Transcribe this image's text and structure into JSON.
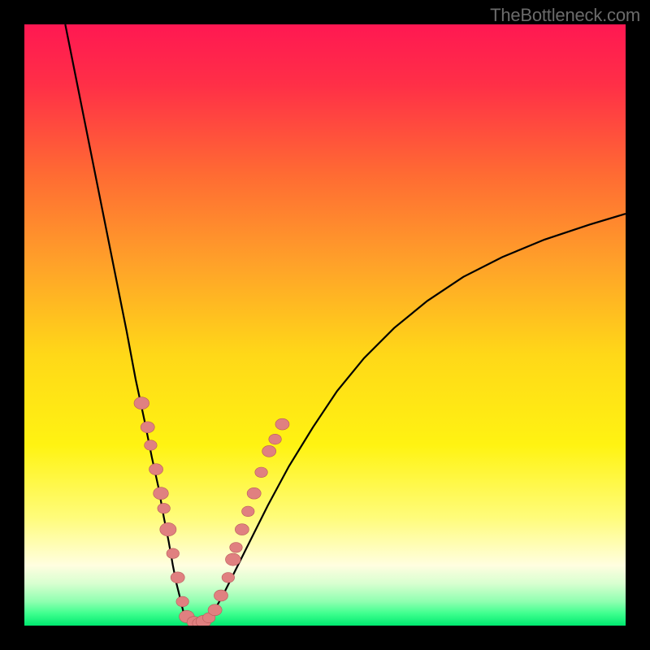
{
  "watermark": "TheBottleneck.com",
  "colors": {
    "background": "#000000",
    "gradient_stops": [
      {
        "offset": 0.0,
        "color": "#ff1852"
      },
      {
        "offset": 0.1,
        "color": "#ff2f47"
      },
      {
        "offset": 0.25,
        "color": "#ff6b33"
      },
      {
        "offset": 0.4,
        "color": "#ffa229"
      },
      {
        "offset": 0.55,
        "color": "#ffd818"
      },
      {
        "offset": 0.7,
        "color": "#fff312"
      },
      {
        "offset": 0.82,
        "color": "#fffc7a"
      },
      {
        "offset": 0.9,
        "color": "#fffee0"
      },
      {
        "offset": 0.93,
        "color": "#d8ffd0"
      },
      {
        "offset": 0.96,
        "color": "#8fffb0"
      },
      {
        "offset": 0.98,
        "color": "#3eff8e"
      },
      {
        "offset": 1.0,
        "color": "#00e86f"
      }
    ],
    "curve": "#000000",
    "dot_fill": "#e08080",
    "dot_stroke": "#b85a5a",
    "watermark": "#6b6b6b"
  },
  "chart_data": {
    "type": "line",
    "title": "",
    "xlabel": "",
    "ylabel": "",
    "xlim": [
      0,
      100
    ],
    "ylim": [
      0,
      100
    ],
    "series": [
      {
        "name": "left-branch",
        "x": [
          6.8,
          9,
          11,
          13,
          15,
          17,
          18.5,
          20,
          21.2,
          22.3,
          23.2,
          24,
          24.7,
          25.3,
          25.8,
          26.2,
          26.5
        ],
        "y": [
          100,
          89,
          79,
          69,
          59,
          49,
          41,
          34,
          28,
          23,
          18,
          14,
          10,
          7,
          5,
          3.3,
          2.1
        ]
      },
      {
        "name": "valley",
        "x": [
          26.5,
          27,
          27.5,
          28,
          28.5,
          29,
          29.5,
          30,
          30.5,
          31,
          31.5
        ],
        "y": [
          2.1,
          1.2,
          0.6,
          0.3,
          0.2,
          0.25,
          0.4,
          0.7,
          1.1,
          1.7,
          2.4
        ]
      },
      {
        "name": "right-branch",
        "x": [
          31.5,
          33,
          35,
          37.5,
          40.5,
          44,
          48,
          52,
          56.5,
          61.5,
          67,
          73,
          79.5,
          86.5,
          94,
          100
        ],
        "y": [
          2.4,
          5,
          9,
          14,
          20,
          26.5,
          33,
          39,
          44.5,
          49.5,
          54,
          58,
          61.3,
          64.2,
          66.7,
          68.5
        ]
      }
    ],
    "dots": {
      "name": "data-points",
      "points": [
        {
          "x": 19.5,
          "y": 37,
          "r": 1.2
        },
        {
          "x": 20.5,
          "y": 33,
          "r": 1.1
        },
        {
          "x": 21.0,
          "y": 30,
          "r": 1.0
        },
        {
          "x": 21.9,
          "y": 26,
          "r": 1.1
        },
        {
          "x": 22.7,
          "y": 22,
          "r": 1.2
        },
        {
          "x": 23.2,
          "y": 19.5,
          "r": 1.0
        },
        {
          "x": 23.9,
          "y": 16,
          "r": 1.3
        },
        {
          "x": 24.7,
          "y": 12,
          "r": 1.0
        },
        {
          "x": 25.5,
          "y": 8,
          "r": 1.1
        },
        {
          "x": 26.3,
          "y": 4,
          "r": 1.0
        },
        {
          "x": 27.0,
          "y": 1.5,
          "r": 1.2
        },
        {
          "x": 28.2,
          "y": 0.6,
          "r": 1.1
        },
        {
          "x": 29.0,
          "y": 0.4,
          "r": 1.0
        },
        {
          "x": 29.8,
          "y": 0.7,
          "r": 1.2
        },
        {
          "x": 30.7,
          "y": 1.3,
          "r": 1.0
        },
        {
          "x": 31.7,
          "y": 2.6,
          "r": 1.1
        },
        {
          "x": 32.7,
          "y": 5,
          "r": 1.1
        },
        {
          "x": 33.9,
          "y": 8,
          "r": 1.0
        },
        {
          "x": 34.7,
          "y": 11,
          "r": 1.2
        },
        {
          "x": 35.2,
          "y": 13,
          "r": 1.0
        },
        {
          "x": 36.2,
          "y": 16,
          "r": 1.1
        },
        {
          "x": 37.2,
          "y": 19,
          "r": 1.0
        },
        {
          "x": 38.2,
          "y": 22,
          "r": 1.1
        },
        {
          "x": 39.4,
          "y": 25.5,
          "r": 1.0
        },
        {
          "x": 40.7,
          "y": 29,
          "r": 1.1
        },
        {
          "x": 41.7,
          "y": 31,
          "r": 1.0
        },
        {
          "x": 42.9,
          "y": 33.5,
          "r": 1.1
        }
      ]
    }
  }
}
